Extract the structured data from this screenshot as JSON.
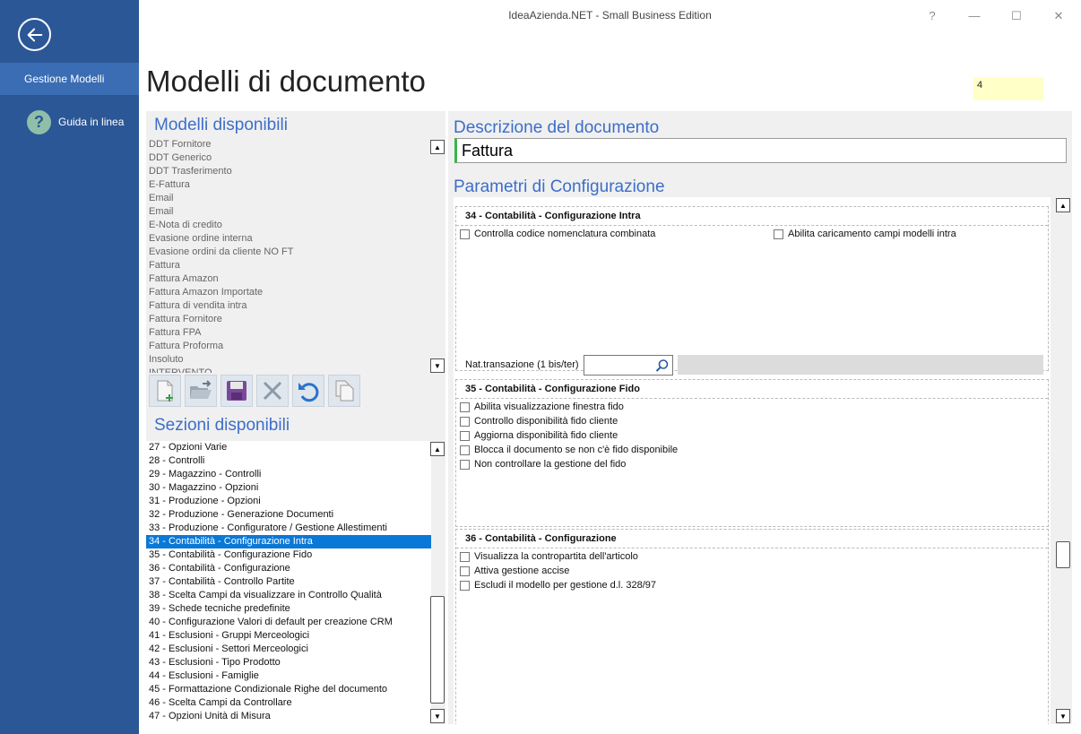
{
  "window": {
    "title": "IdeaAzienda.NET - Small Business Edition",
    "help_label": "?",
    "minimize_label": "—",
    "maximize_label": "☐",
    "close_label": "✕"
  },
  "sidebar": {
    "active_item": "Gestione Modelli",
    "help_item": "Guida in linea",
    "help_icon_glyph": "?"
  },
  "page": {
    "title": "Modelli di documento",
    "user_value": "4"
  },
  "models": {
    "title": "Modelli disponibili",
    "items": [
      "DDT Fornitore",
      "DDT Generico",
      "DDT Trasferimento",
      "E-Fattura",
      "Email",
      "Email",
      "E-Nota di credito",
      "Evasione ordine interna",
      "Evasione ordini da cliente NO FT",
      "Fattura",
      "Fattura Amazon",
      "Fattura Amazon Importate",
      "Fattura di vendita intra",
      "Fattura Fornitore",
      "Fattura FPA",
      "Fattura Proforma",
      "Insoluto",
      "INTERVENTO"
    ]
  },
  "toolbar": {
    "buttons": [
      "new-document",
      "open-folder",
      "save",
      "delete",
      "undo",
      "copy"
    ]
  },
  "sections": {
    "title": "Sezioni disponibili",
    "items": [
      "27 - Opzioni Varie",
      "28 - Controlli",
      "29 - Magazzino - Controlli",
      "30 - Magazzino - Opzioni",
      "31 - Produzione - Opzioni",
      "32 - Produzione - Generazione Documenti",
      "33 - Produzione - Configuratore / Gestione Allestimenti",
      "34 - Contabilità - Configurazione Intra",
      "35 - Contabilità - Configurazione Fido",
      "36 - Contabilità - Configurazione",
      "37 - Contabilità - Controllo Partite",
      "38 - Scelta Campi da visualizzare in Controllo Qualità",
      "39 - Schede tecniche predefinite",
      "40 - Configurazione Valori di default per creazione CRM",
      "41 - Esclusioni - Gruppi Merceologici",
      "42 - Esclusioni - Settori Merceologici",
      "43 - Esclusioni - Tipo Prodotto",
      "44 - Esclusioni - Famiglie",
      "45 - Formattazione Condizionale Righe del documento",
      "46 - Scelta Campi da Controllare",
      "47 - Opzioni Unità di Misura"
    ],
    "selected_index": 7
  },
  "description": {
    "title": "Descrizione del documento",
    "value": "Fattura"
  },
  "params": {
    "title": "Parametri di Configurazione",
    "block34": {
      "title": "34 - Contabilità - Configurazione Intra",
      "cb1": "Controlla codice nomenclatura combinata",
      "cb2": "Abilita caricamento campi modelli intra",
      "nat_label": "Nat.transazione (1 bis/ter)"
    },
    "block35": {
      "title": "35 - Contabilità - Configurazione Fido",
      "cb1": "Abilita visualizzazione finestra fido",
      "cb2": "Controllo disponibilità fido cliente",
      "cb3": "Aggiorna disponibilità fido cliente",
      "cb4": "Blocca il documento se non c'è fido disponibile",
      "cb5": "Non controllare la gestione del fido"
    },
    "block36": {
      "title": "36 - Contabilità - Configurazione",
      "cb1": "Visualizza la contropartita dell'articolo",
      "cb2": "Attiva gestione accise",
      "cb3": "Escludi il modello per gestione d.l. 328/97"
    }
  },
  "colors": {
    "sidebar_bg": "#2b5797",
    "accent_title": "#3d6ec9",
    "selection": "#0a78d7",
    "field_marker": "#3cb44b",
    "user_box": "#ffffc8"
  }
}
